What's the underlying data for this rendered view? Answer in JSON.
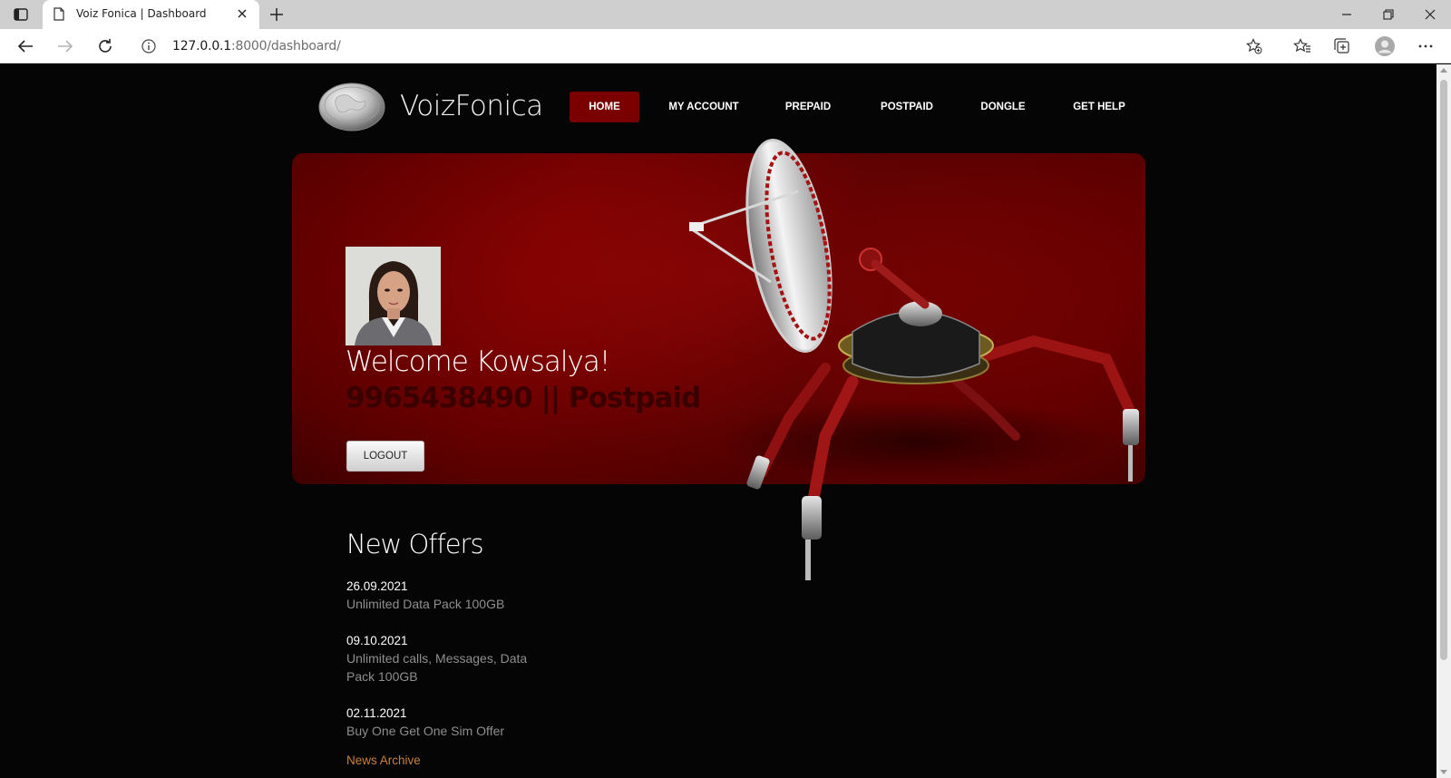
{
  "browser": {
    "tab_title": "Voiz Fonica | Dashboard",
    "url_host": "127.0.0.1",
    "url_path": ":8000/dashboard/"
  },
  "site": {
    "brand": "VoizFonica",
    "nav": [
      "HOME",
      "MY ACCOUNT",
      "PREPAID",
      "POSTPAID",
      "DONGLE",
      "GET HELP"
    ],
    "active_nav": "HOME"
  },
  "hero": {
    "welcome": "Welcome Kowsalya!",
    "subline": "9965438490 || Postpaid",
    "logout_label": "LOGOUT"
  },
  "offers": {
    "title": "New Offers",
    "items": [
      {
        "date": "26.09.2021",
        "desc": "Unlimited Data Pack 100GB"
      },
      {
        "date": "09.10.2021",
        "desc": "Unlimited calls, Messages, Data Pack 100GB"
      },
      {
        "date": "02.11.2021",
        "desc": "Buy One Get One Sim Offer"
      }
    ],
    "archive_label": "News Archive"
  },
  "colors": {
    "accent": "#7a0000",
    "hero_red": "#820202",
    "archive_link": "#c9803a"
  }
}
